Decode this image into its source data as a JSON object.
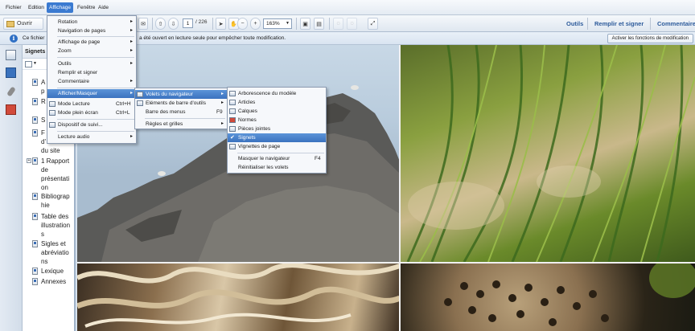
{
  "menubar": {
    "items": [
      "Fichier",
      "Edition",
      "Affichage",
      "Fenêtre",
      "Aide"
    ]
  },
  "toolbar": {
    "open_label": "Ouvrir",
    "page_current": "1",
    "page_total": "/ 226",
    "zoom": "163%",
    "tools_label": "Outils",
    "fill_sign_label": "Remplir et signer",
    "comment_label": "Commentaire"
  },
  "infobar": {
    "text_left": "Ce fichier",
    "text_right": "a été ouvert en lecture seule pour empêcher toute modification.",
    "activate_label": "Activer les fonctions de modification"
  },
  "navpanel": {
    "title": "Signets",
    "bookmarks": [
      "A",
      "p",
      "R",
      "S",
      "F",
      "d'",
      "du site",
      "1 Rapport",
      "de",
      "présentati",
      "on",
      "Bibliograp",
      "hie",
      "Table des",
      "illustration",
      "s",
      "Sigles et",
      "abréviatio",
      "ns",
      "Lexique",
      "Annexes"
    ]
  },
  "menu_affichage": {
    "items": [
      {
        "label": "Rotation",
        "arrow": "▸"
      },
      {
        "label": "Navigation de pages",
        "arrow": "▸"
      },
      {
        "label": "Affichage de page",
        "arrow": "▸"
      },
      {
        "label": "Zoom",
        "arrow": "▸"
      },
      {
        "label": "Outils",
        "arrow": "▸"
      },
      {
        "label": "Remplir et signer"
      },
      {
        "label": "Commentaire",
        "arrow": "▸"
      },
      {
        "label": "Afficher/Masquer",
        "arrow": "▸"
      },
      {
        "label": "Mode Lecture",
        "shortcut": "Ctrl+H"
      },
      {
        "label": "Mode plein écran",
        "shortcut": "Ctrl+L"
      },
      {
        "label": "Dispositif de suivi..."
      },
      {
        "label": "Lecture audio",
        "arrow": "▸"
      }
    ]
  },
  "menu_afficher_masquer": {
    "items": [
      {
        "label": "Volets du navigateur",
        "arrow": "▸"
      },
      {
        "label": "Eléments de barre d'outils",
        "arrow": "▸"
      },
      {
        "label": "Barre des menus",
        "shortcut": "F9"
      },
      {
        "label": "Règles et grilles",
        "arrow": "▸"
      }
    ]
  },
  "menu_volets": {
    "items": [
      {
        "label": "Arborescence du modèle"
      },
      {
        "label": "Articles"
      },
      {
        "label": "Calques"
      },
      {
        "label": "Normes"
      },
      {
        "label": "Pièces jointes"
      },
      {
        "label": "Signets",
        "check": "✔"
      },
      {
        "label": "Vignettes de page"
      },
      {
        "label": "Masquer le navigateur",
        "shortcut": "F4"
      },
      {
        "label": "Réinitialiser les volets"
      }
    ]
  },
  "colors": {
    "menu_highlight": "#3b72bf",
    "link": "#2d5b9b"
  }
}
